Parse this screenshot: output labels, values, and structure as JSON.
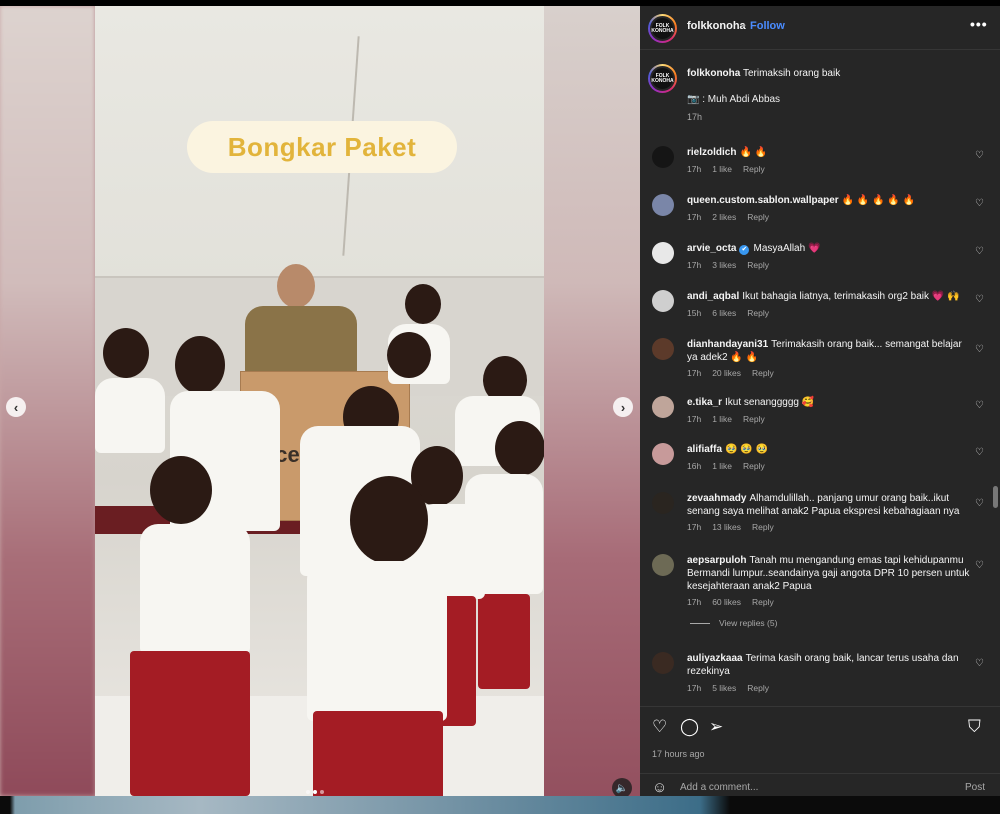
{
  "media": {
    "overlay_caption": "Bongkar Paket",
    "box_brand": "ece",
    "prev_icon": "chevron-left-icon",
    "next_icon": "chevron-right-icon",
    "audio_icon": "speaker-icon"
  },
  "header": {
    "username": "folkkonoha",
    "separator": "•",
    "follow_label": "Follow",
    "avatar_text": "FOLK KONOHA",
    "more_label": "•••"
  },
  "caption": {
    "username": "folkkonoha",
    "text": "Terimaksih orang baik",
    "credit": "📷 : Muh Abdi Abbas",
    "time": "17h"
  },
  "comments": [
    {
      "username": "rielzoldich",
      "text": "🔥 🔥",
      "time": "17h",
      "likes": "1 like",
      "reply": "Reply",
      "color": "#151515"
    },
    {
      "username": "queen.custom.sablon.wallpaper",
      "text": "🔥 🔥 🔥 🔥 🔥",
      "time": "17h",
      "likes": "2 likes",
      "reply": "Reply",
      "color": "#7a86a8"
    },
    {
      "username": "arvie_octa",
      "text": "MasyaAllah 💗",
      "time": "17h",
      "likes": "3 likes",
      "reply": "Reply",
      "color": "#e8e8e8",
      "verified": "✔"
    },
    {
      "username": "andi_aqbal",
      "text": "Ikut bahagia liatnya, terimakasih org2 baik 💗 🙌",
      "time": "15h",
      "likes": "6 likes",
      "reply": "Reply",
      "color": "#cfcfcf"
    },
    {
      "username": "dianhandayani31",
      "text": "Terimakasih orang baik... semangat belajar ya adek2 🔥 🔥",
      "time": "17h",
      "likes": "20 likes",
      "reply": "Reply",
      "color": "#5c3a2a"
    },
    {
      "username": "e.tika_r",
      "text": "Ikut senanggggg 🥰",
      "time": "17h",
      "likes": "1 like",
      "reply": "Reply",
      "color": "#bfa59a"
    },
    {
      "username": "alifiaffa",
      "text": "🥹 🥹 🥹",
      "time": "16h",
      "likes": "1 like",
      "reply": "Reply",
      "color": "#c79a9a"
    },
    {
      "username": "zevaahmady",
      "text": "Alhamdulillah.. panjang umur orang baik..ikut senang saya melihat anak2 Papua ekspresi kebahagiaan nya",
      "time": "17h",
      "likes": "13 likes",
      "reply": "Reply",
      "color": "#2a2520"
    },
    {
      "username": "aepsarpuloh",
      "text": "Tanah mu mengandung emas tapi kehidupanmu Bermandi lumpur..seandainya gaji angota DPR 10 persen untuk kesejahteraan anak2 Papua",
      "time": "17h",
      "likes": "60 likes",
      "reply": "Reply",
      "color": "#6d6a55"
    },
    {
      "username": "auliyazkaaa",
      "text": "Terima kasih orang baik, lancar terus usaha dan rezekinya",
      "time": "17h",
      "likes": "5 likes",
      "reply": "Reply",
      "color": "#3a2a22"
    }
  ],
  "view_replies": "View replies (5)",
  "actions": {
    "like_icon": "heart-icon",
    "comment_icon": "comment-icon",
    "share_icon": "share-icon",
    "save_icon": "bookmark-icon",
    "posted": "17 hours ago"
  },
  "add_comment": {
    "placeholder": "Add a comment...",
    "post_label": "Post",
    "emoji_icon": "smiley-icon"
  }
}
